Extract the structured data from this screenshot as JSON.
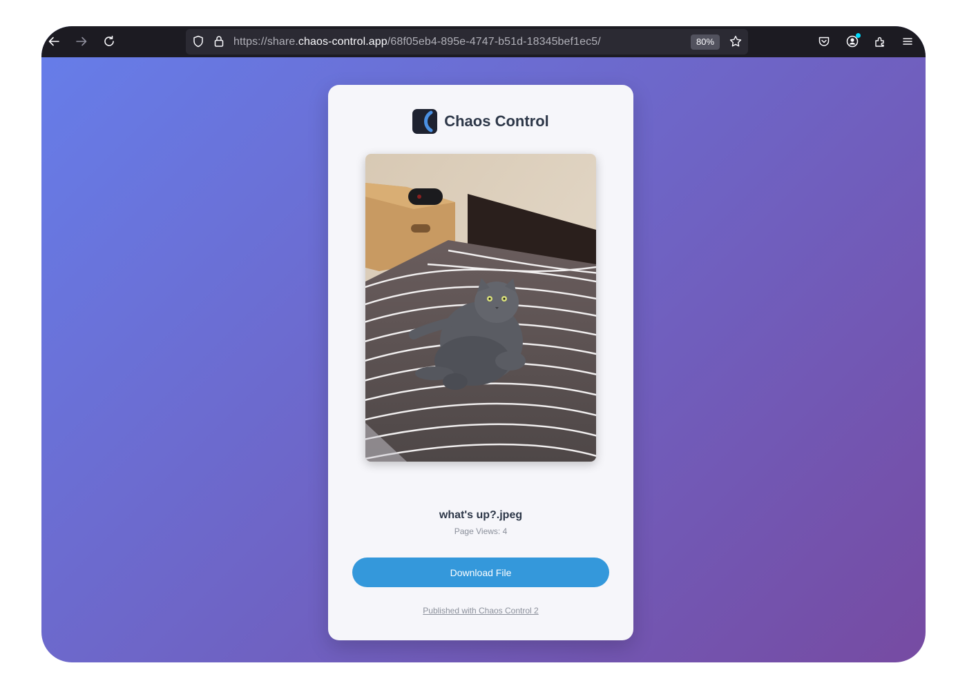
{
  "browser": {
    "url_prefix": "https://share.",
    "url_host": "chaos-control.app",
    "url_path": "/68f05eb4-895e-4747-b51d-18345bef1ec5/",
    "zoom": "80%",
    "icons": {
      "back": "back-arrow-icon",
      "forward": "forward-arrow-icon",
      "reload": "reload-icon",
      "tracking": "shield-icon",
      "lock": "lock-icon",
      "bookmark": "star-icon",
      "pocket": "pocket-icon",
      "account": "account-icon",
      "extensions": "extensions-icon",
      "menu": "hamburger-menu-icon"
    }
  },
  "page": {
    "brand_name": "Chaos Control",
    "file_name": "what's up?.jpeg",
    "page_views": "Page Views: 4",
    "download_label": "Download File",
    "footer_text": "Published with Chaos Control 2"
  },
  "colors": {
    "gradient_start": "#667eea",
    "gradient_end": "#764ba2",
    "button": "#3498db",
    "heading": "#2d3748",
    "toolbar": "#1c1b22"
  }
}
